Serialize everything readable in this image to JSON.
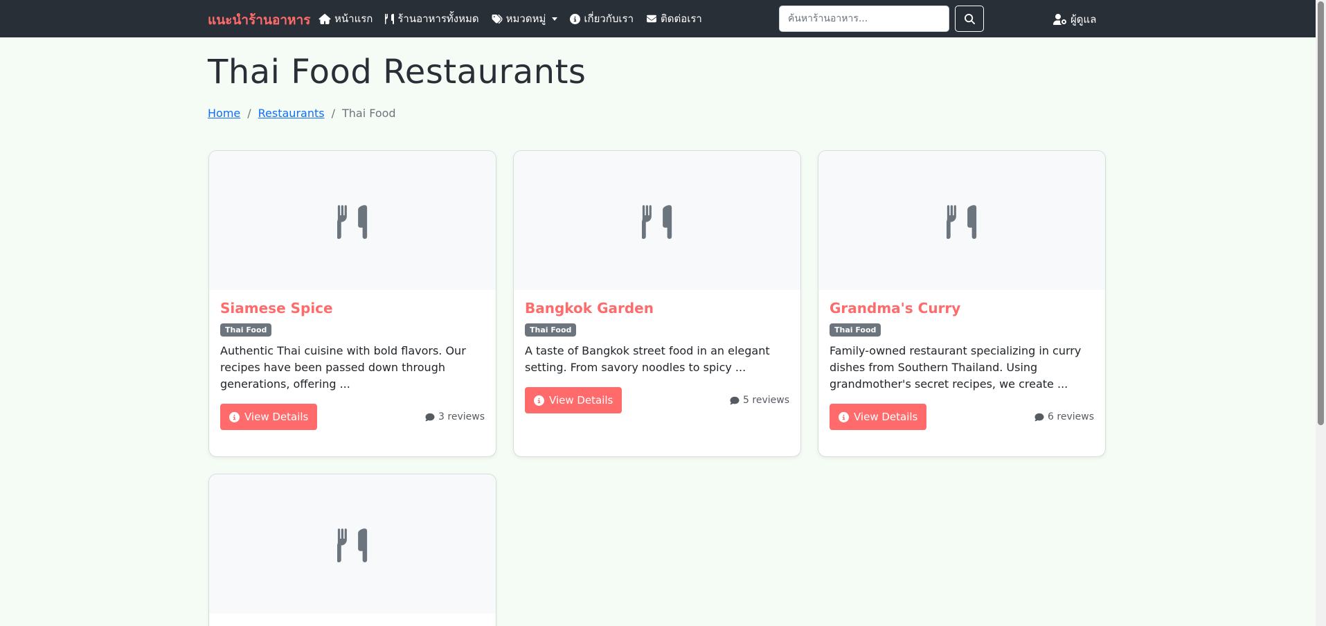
{
  "nav": {
    "brand": "แนะนำร้านอาหาร",
    "links": [
      {
        "label": "หน้าแรก",
        "icon": "home-icon"
      },
      {
        "label": "ร้านอาหารทั้งหมด",
        "icon": "utensils-icon"
      },
      {
        "label": "หมวดหมู่",
        "icon": "tags-icon"
      },
      {
        "label": "เกี่ยวกับเรา",
        "icon": "info-icon"
      },
      {
        "label": "ติดต่อเรา",
        "icon": "envelope-icon"
      }
    ],
    "search_placeholder": "ค้นหาร้านอาหาร...",
    "admin_label": "ผู้ดูแล"
  },
  "page": {
    "title": "Thai Food Restaurants",
    "breadcrumb": [
      "Home",
      "Restaurants",
      "Thai Food"
    ]
  },
  "restaurants": [
    {
      "name": "Siamese Spice",
      "category": "Thai Food",
      "description": "Authentic Thai cuisine with bold flavors. Our recipes have been passed down through generations, offering ...",
      "button": "View Details",
      "reviews": "3 reviews"
    },
    {
      "name": "Bangkok Garden",
      "category": "Thai Food",
      "description": "A taste of Bangkok street food in an elegant setting. From savory noodles to spicy ...",
      "button": "View Details",
      "reviews": "5 reviews"
    },
    {
      "name": "Grandma's Curry",
      "category": "Thai Food",
      "description": "Family-owned restaurant specializing in curry dishes from Southern Thailand. Using grandmother's secret recipes, we create ...",
      "button": "View Details",
      "reviews": "6 reviews"
    },
    {
      "name": "",
      "category": "",
      "description": "",
      "button": "",
      "reviews": ""
    }
  ],
  "colors": {
    "accent": "#ff6b6b",
    "navbar": "#292f36",
    "background": "#f5fcf5",
    "badge": "#6c757d"
  }
}
